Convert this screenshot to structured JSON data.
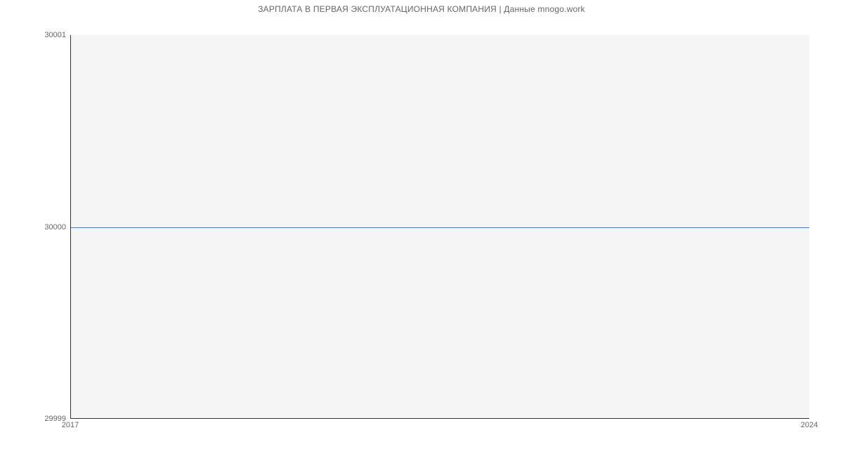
{
  "chart_data": {
    "type": "line",
    "title": "ЗАРПЛАТА В ПЕРВАЯ ЭКСПЛУАТАЦИОННАЯ КОМПАНИЯ | Данные mnogo.work",
    "x": [
      2017,
      2024
    ],
    "values": [
      30000,
      30000
    ],
    "x_ticks": [
      "2017",
      "2024"
    ],
    "y_ticks": [
      "29999",
      "30000",
      "30001"
    ],
    "xlim": [
      2017,
      2024
    ],
    "ylim": [
      29999,
      30001
    ],
    "xlabel": "",
    "ylabel": ""
  }
}
